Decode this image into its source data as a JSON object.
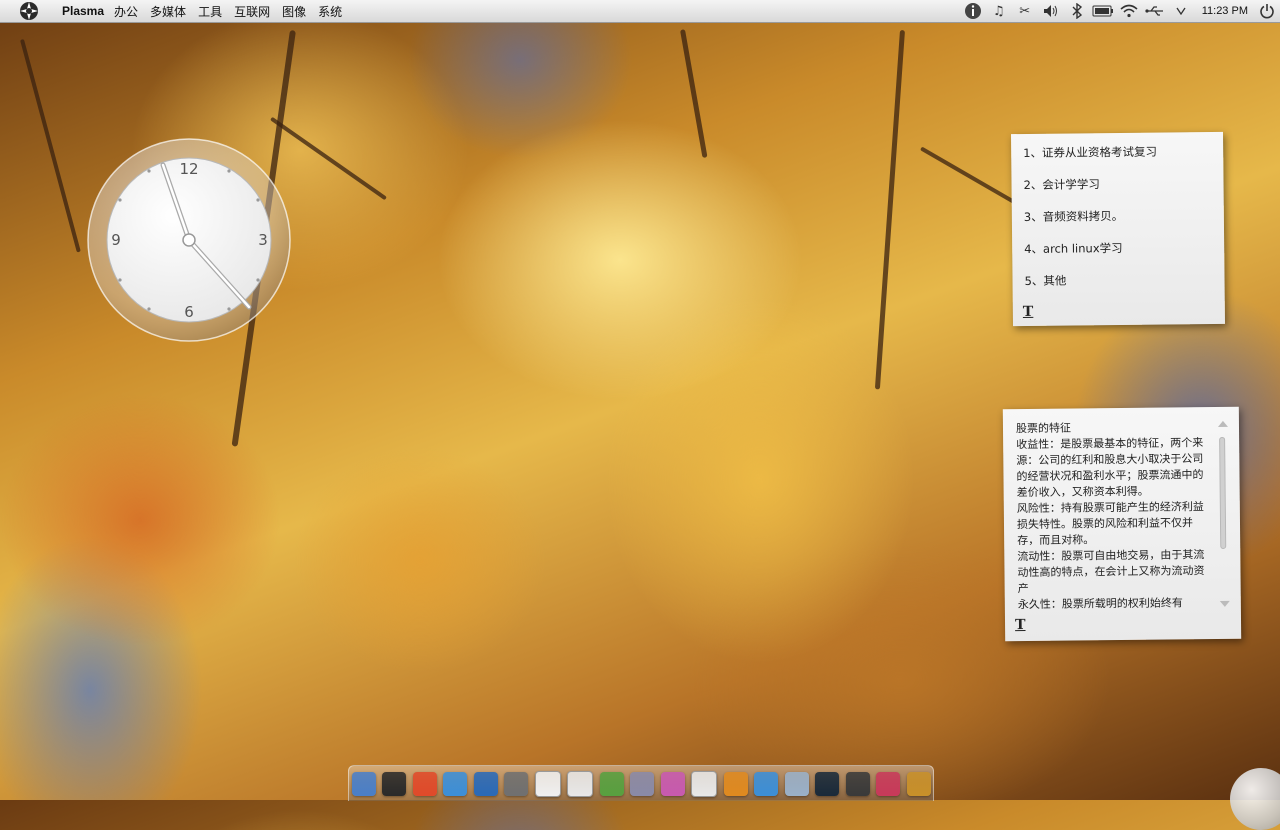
{
  "top_panel": {
    "app_name": "Plasma",
    "menus": [
      "办公",
      "多媒体",
      "工具",
      "互联网",
      "图像",
      "系统"
    ],
    "tray_icons": [
      "info-icon",
      "music-icon",
      "scissors-icon",
      "volume-icon",
      "bluetooth-icon",
      "battery-icon",
      "wifi-icon",
      "usb-icon",
      "dropdown-icon"
    ],
    "clock": "11:23 PM",
    "power_icon": "power-icon"
  },
  "clock_widget": {
    "numerals": {
      "twelve": "12",
      "three": "3",
      "six": "6",
      "nine": "9"
    },
    "time": "11:23"
  },
  "note_todo": {
    "items": [
      "1、证券从业资格考试复习",
      "2、会计学学习",
      "3、音频资料拷贝。",
      "4、arch linux学习",
      "5、其他"
    ],
    "format_icon": "T"
  },
  "note_stock": {
    "title": "股票的特征",
    "paragraphs": [
      "收益性：是股票最基本的特征，两个来源：公司的红利和股息大小取决于公司的经营状况和盈利水平；股票流通中的差价收入，又称资本利得。",
      "风险性：持有股票可能产生的经济利益损失特性。股票的风险和利益不仅并存，而且对称。",
      "流动性：股票可自由地交易，由于其流动性高的特点，在会计上又称为流动资产",
      "永久性：股票所载明的权利始终有"
    ],
    "format_icon": "T"
  },
  "dock": {
    "items": [
      {
        "name": "file-manager-icon",
        "color": "#4a7fc8"
      },
      {
        "name": "terminal-icon",
        "color": "#2a2a2a"
      },
      {
        "name": "chrome-icon",
        "color": "#e04a2a"
      },
      {
        "name": "globe-icon",
        "color": "#3c8fd8"
      },
      {
        "name": "safari-icon",
        "color": "#2a6ab8"
      },
      {
        "name": "tools-icon",
        "color": "#707070"
      },
      {
        "name": "document-icon",
        "color": "#f0f0f0"
      },
      {
        "name": "image-viewer-icon",
        "color": "#e8e8e8"
      },
      {
        "name": "music-player-icon",
        "color": "#58a040"
      },
      {
        "name": "paint-icon",
        "color": "#8a8aa8"
      },
      {
        "name": "media-player-icon",
        "color": "#c85ab0"
      },
      {
        "name": "text-editor-icon",
        "color": "#e8e8e8"
      },
      {
        "name": "office-icon",
        "color": "#e08a20"
      },
      {
        "name": "network-icon",
        "color": "#3c8fd8"
      },
      {
        "name": "search-icon",
        "color": "#9ab0c8"
      },
      {
        "name": "dark-globe-icon",
        "color": "#1a2a3a"
      },
      {
        "name": "monitor-icon",
        "color": "#3a3a3a"
      },
      {
        "name": "eye-icon",
        "color": "#c83a5a"
      },
      {
        "name": "gold-ball-icon",
        "color": "#c8902a"
      }
    ]
  }
}
